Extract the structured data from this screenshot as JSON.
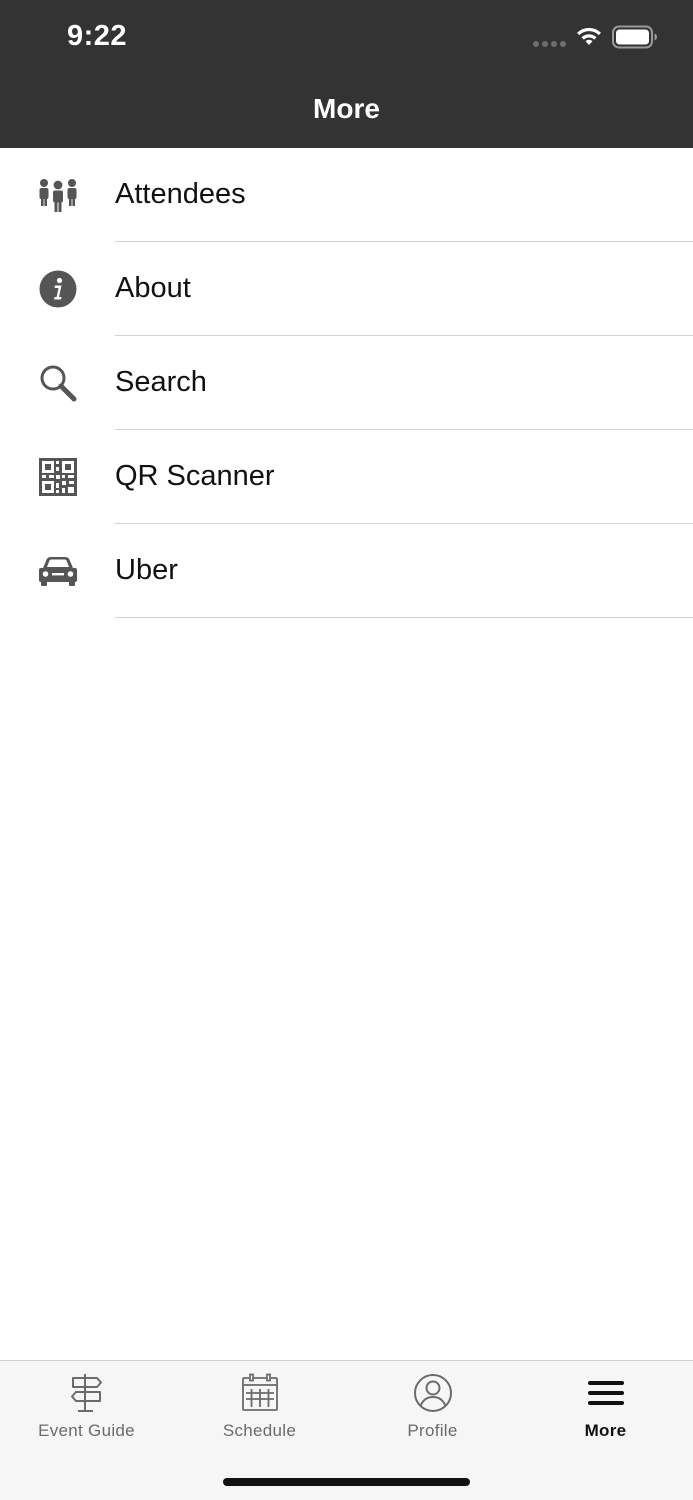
{
  "status_bar": {
    "time": "9:22"
  },
  "header": {
    "title": "More"
  },
  "menu": [
    {
      "label": "Attendees",
      "icon": "people-icon"
    },
    {
      "label": "About",
      "icon": "info-icon"
    },
    {
      "label": "Search",
      "icon": "search-icon"
    },
    {
      "label": "QR Scanner",
      "icon": "qr-code-icon"
    },
    {
      "label": "Uber",
      "icon": "car-icon"
    }
  ],
  "tabs": [
    {
      "label": "Event Guide",
      "icon": "signpost-icon",
      "active": false
    },
    {
      "label": "Schedule",
      "icon": "calendar-icon",
      "active": false
    },
    {
      "label": "Profile",
      "icon": "profile-icon",
      "active": false
    },
    {
      "label": "More",
      "icon": "hamburger-menu-icon",
      "active": true
    }
  ],
  "colors": {
    "header_bg": "#333333",
    "icon_gray": "#555555",
    "divider": "#d4d4d4",
    "tab_inactive": "#6b6b6b",
    "tab_active": "#111111"
  }
}
